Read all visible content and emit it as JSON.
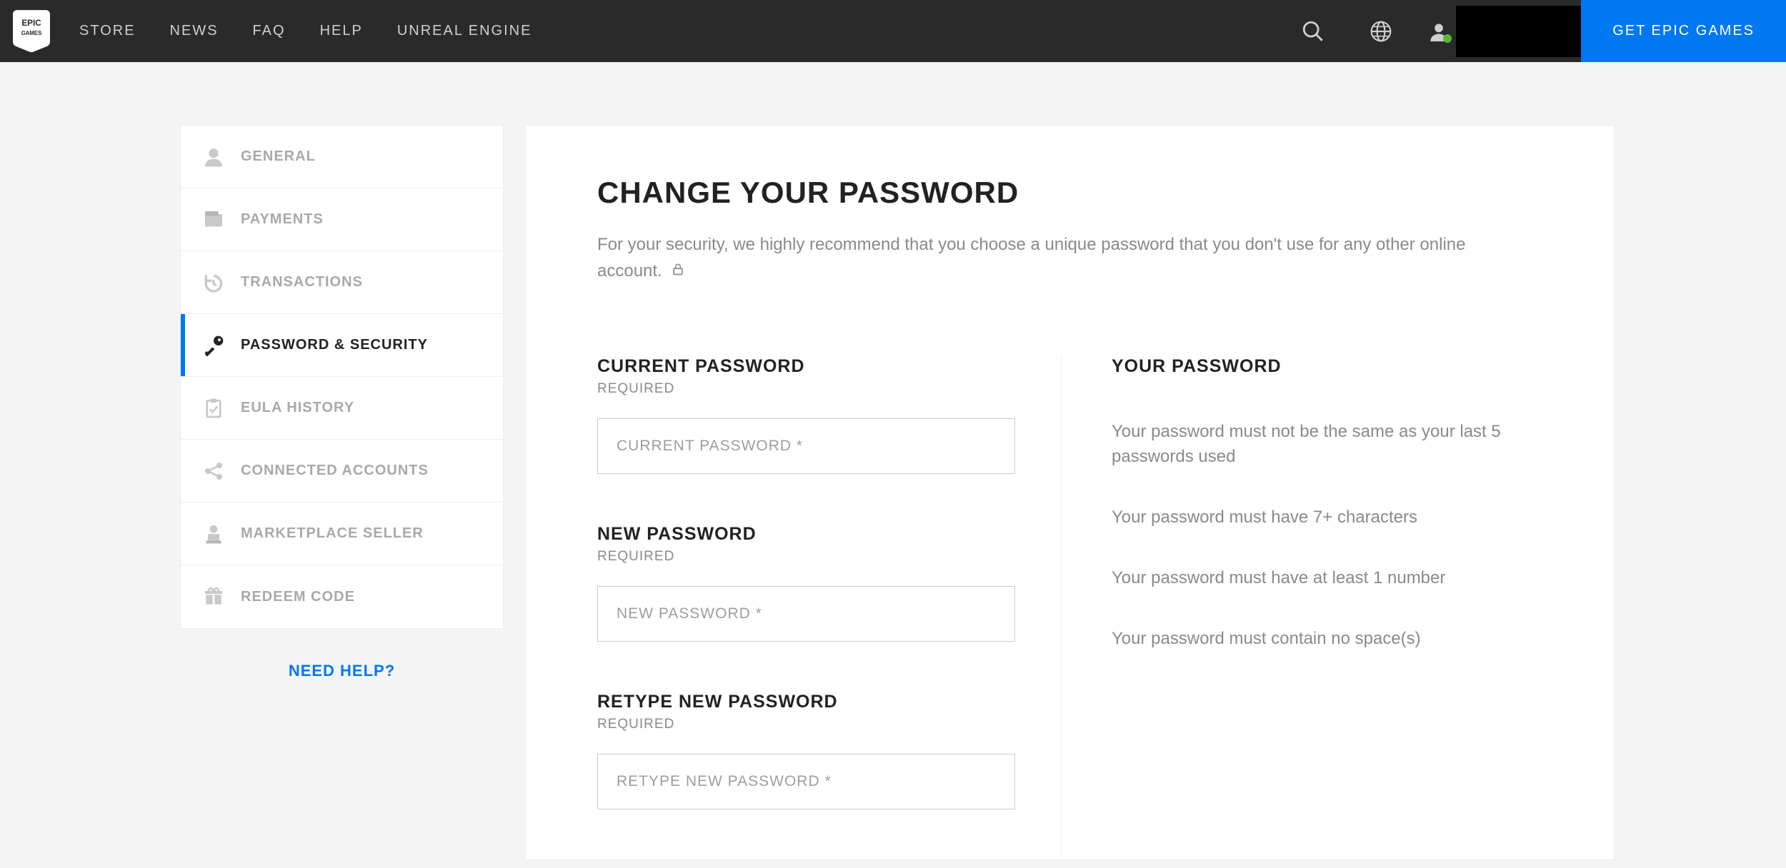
{
  "header": {
    "nav": [
      {
        "label": "STORE"
      },
      {
        "label": "NEWS"
      },
      {
        "label": "FAQ"
      },
      {
        "label": "HELP"
      },
      {
        "label": "UNREAL ENGINE"
      }
    ],
    "cta": "GET EPIC GAMES"
  },
  "sidebar": {
    "items": [
      {
        "label": "GENERAL"
      },
      {
        "label": "PAYMENTS"
      },
      {
        "label": "TRANSACTIONS"
      },
      {
        "label": "PASSWORD & SECURITY"
      },
      {
        "label": "EULA HISTORY"
      },
      {
        "label": "CONNECTED ACCOUNTS"
      },
      {
        "label": "MARKETPLACE SELLER"
      },
      {
        "label": "REDEEM CODE"
      }
    ],
    "help": "NEED HELP?"
  },
  "main": {
    "title": "CHANGE YOUR PASSWORD",
    "subtitle": "For your security, we highly recommend that you choose a unique password that you don't use for any other online account.",
    "fields": {
      "current": {
        "label": "CURRENT PASSWORD",
        "req": "REQUIRED",
        "placeholder": "CURRENT PASSWORD *"
      },
      "new": {
        "label": "NEW PASSWORD",
        "req": "REQUIRED",
        "placeholder": "NEW PASSWORD *"
      },
      "retype": {
        "label": "RETYPE NEW PASSWORD",
        "req": "REQUIRED",
        "placeholder": "RETYPE NEW PASSWORD *"
      }
    },
    "rules": {
      "title": "YOUR PASSWORD",
      "list": [
        "Your password must not be the same as your last 5 passwords used",
        "Your password must have 7+ characters",
        "Your password must have at least 1 number",
        "Your password must contain no space(s)"
      ]
    }
  }
}
